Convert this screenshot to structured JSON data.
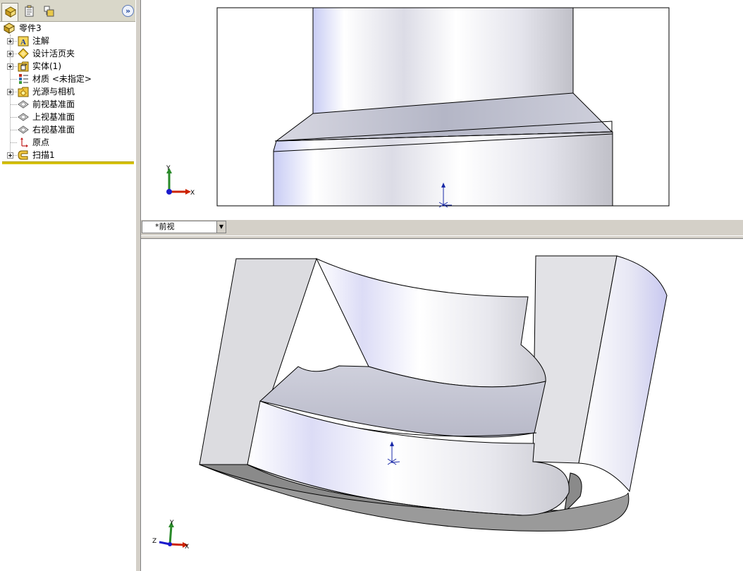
{
  "feature_tree": {
    "root": {
      "label": "零件3",
      "icon": "part-icon"
    },
    "items": [
      {
        "label": "注解",
        "icon": "annotations-icon",
        "expandable": true
      },
      {
        "label": "设计活页夹",
        "icon": "design-binder-icon",
        "expandable": true
      },
      {
        "label": "实体(1)",
        "icon": "solid-bodies-icon",
        "expandable": true
      },
      {
        "label": "材质 <未指定>",
        "icon": "material-icon",
        "expandable": false
      },
      {
        "label": "光源与相机",
        "icon": "lights-cameras-icon",
        "expandable": true
      },
      {
        "label": "前视基准面",
        "icon": "plane-icon",
        "expandable": false
      },
      {
        "label": "上视基准面",
        "icon": "plane-icon",
        "expandable": false
      },
      {
        "label": "右视基准面",
        "icon": "plane-icon",
        "expandable": false
      },
      {
        "label": "原点",
        "icon": "origin-icon",
        "expandable": false
      },
      {
        "label": "扫描1",
        "icon": "sweep-feature-icon",
        "expandable": true
      }
    ]
  },
  "panel_tabs": [
    "feature-manager-tab",
    "property-manager-tab",
    "configuration-manager-tab"
  ],
  "viewports": {
    "top": {
      "view_name": "*前视"
    },
    "triad_labels": {
      "x": "X",
      "y": "Y",
      "z": "Z"
    }
  },
  "colors": {
    "rollback_bar": "#d6c200",
    "axis_x": "#cc2200",
    "axis_y": "#2a8a2a",
    "axis_z": "#1a1acc",
    "origin": "#1a2aa8"
  }
}
